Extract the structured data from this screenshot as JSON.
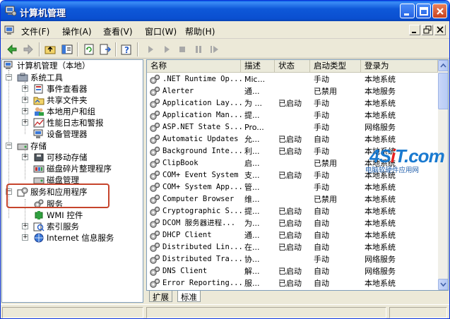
{
  "window": {
    "title": "计算机管理",
    "accent": "#0a4fd0"
  },
  "menu": {
    "items": [
      "文件(F)",
      "操作(A)",
      "查看(V)",
      "窗口(W)",
      "帮助(H)"
    ]
  },
  "tree": {
    "root": "计算机管理（本地）",
    "system_tools": "系统工具",
    "event_viewer": "事件查看器",
    "shared_folders": "共享文件夹",
    "local_users": "本地用户和组",
    "perf_logs": "性能日志和警报",
    "device_manager": "设备管理器",
    "storage": "存储",
    "removable": "可移动存储",
    "defrag": "磁盘碎片整理程序",
    "disk_mgmt": "磁盘管理",
    "services_apps": "服务和应用程序",
    "services": "服务",
    "wmi": "WMI 控件",
    "indexing": "索引服务",
    "iis": "Internet 信息服务"
  },
  "list": {
    "columns": [
      "名称",
      "描述",
      "状态",
      "启动类型",
      "登录为"
    ],
    "rows": [
      [
        ".NET Runtime Op...",
        "Mic...",
        "",
        "手动",
        "本地系统"
      ],
      [
        "Alerter",
        "通...",
        "",
        "已禁用",
        "本地服务"
      ],
      [
        "Application Lay...",
        "为 ...",
        "已启动",
        "手动",
        "本地系统"
      ],
      [
        "Application Man...",
        "提...",
        "",
        "手动",
        "本地系统"
      ],
      [
        "ASP.NET State S...",
        "Pro...",
        "",
        "手动",
        "网络服务"
      ],
      [
        "Automatic Updates",
        "允...",
        "已启动",
        "自动",
        "本地系统"
      ],
      [
        "Background Inte...",
        "利...",
        "已启动",
        "手动",
        "本地系统"
      ],
      [
        "ClipBook",
        "启...",
        "",
        "已禁用",
        "本地系统"
      ],
      [
        "COM+ Event System",
        "支...",
        "已启动",
        "手动",
        "本地系统"
      ],
      [
        "COM+ System App...",
        "管...",
        "",
        "手动",
        "本地系统"
      ],
      [
        "Computer Browser",
        "维...",
        "",
        "已禁用",
        "本地系统"
      ],
      [
        "Cryptographic S...",
        "提...",
        "已启动",
        "自动",
        "本地系统"
      ],
      [
        "DCOM 服务器进程...",
        "为...",
        "已启动",
        "自动",
        "本地系统"
      ],
      [
        "DHCP Client",
        "通...",
        "已启动",
        "自动",
        "本地系统"
      ],
      [
        "Distributed Lin...",
        "在...",
        "已启动",
        "自动",
        "本地系统"
      ],
      [
        "Distributed Tra...",
        "协...",
        "",
        "手动",
        "网络服务"
      ],
      [
        "DNS Client",
        "解...",
        "已启动",
        "自动",
        "网络服务"
      ],
      [
        "Error Reporting...",
        "服...",
        "已启动",
        "自动",
        "本地系统"
      ]
    ]
  },
  "tabs": [
    "扩展",
    "标准"
  ],
  "watermark": {
    "logo_a": "4S",
    "logo_b": "i",
    "logo_c": "T.com",
    "sub": "电脑软硬件应用网"
  }
}
